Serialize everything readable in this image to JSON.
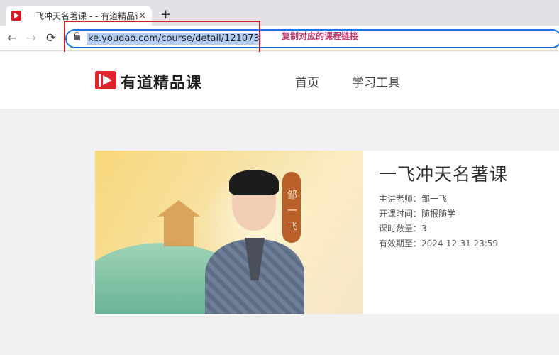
{
  "browser": {
    "tab": {
      "title": "一飞冲天名著课 - - 有道精品课",
      "close": "×"
    },
    "new_tab": "+",
    "nav": {
      "back": "←",
      "forward": "→",
      "reload": "⟳"
    },
    "address_bar": {
      "url": "ke.youdao.com/course/detail/121073"
    }
  },
  "annotation": {
    "text": "复制对应的课程链接",
    "color": "#c23a6a",
    "box_color": "#c8232c"
  },
  "site": {
    "logo_text": "有道精品课",
    "nav": [
      {
        "label": "首页"
      },
      {
        "label": "学习工具"
      }
    ]
  },
  "course": {
    "title": "一飞冲天名著课",
    "cover_name_tag": "邹一飞",
    "details": [
      {
        "text": "主讲老师：邹一飞"
      },
      {
        "text": "开课时间：随报随学"
      },
      {
        "text": "课时数量：3"
      },
      {
        "text": "有效期至：2024-12-31 23:59"
      }
    ]
  },
  "colors": {
    "brand_red": "#e0232d",
    "selection": "#b3cdf2",
    "focus_ring": "#1a73e8"
  }
}
